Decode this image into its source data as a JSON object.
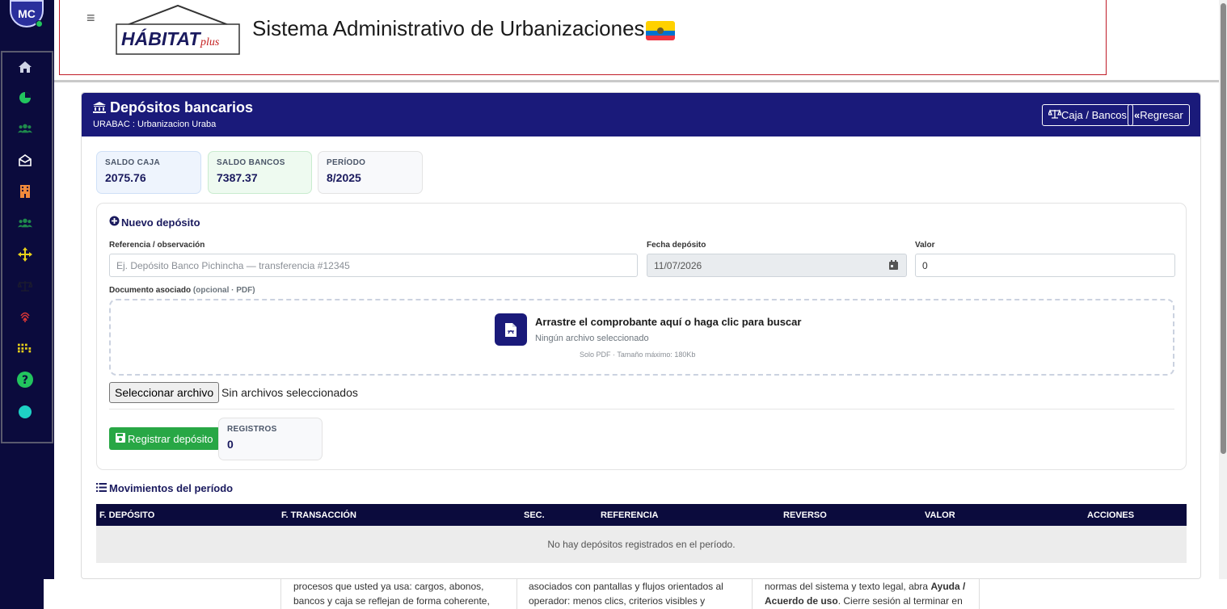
{
  "user": {
    "initials": "MC"
  },
  "header": {
    "logo_text": "HÁBITAT",
    "logo_suffix": "plus",
    "title": "Sistema Administrativo de Urbanizaciones"
  },
  "sidebar": {
    "icons": [
      "home-icon",
      "pie-chart-icon",
      "users-icon",
      "envelope-open-icon",
      "building-icon",
      "users-icon",
      "arrows-icon",
      "scale-icon",
      "fingerprint-icon",
      "grid-dots-icon",
      "help-icon",
      "circle-icon"
    ]
  },
  "page": {
    "title": "Depósitos bancarios",
    "subtitle": "URABAC : Urbanizacion Uraba",
    "caja_bancos_label": "Caja / Bancos",
    "regresar_label": "Regresar"
  },
  "stats": {
    "saldo_caja_label": "SALDO CAJA",
    "saldo_caja_value": "2075.76",
    "saldo_bancos_label": "SALDO BANCOS",
    "saldo_bancos_value": "7387.37",
    "periodo_label": "PERÍODO",
    "periodo_value": "8/2025"
  },
  "form": {
    "section_title": "Nuevo depósito",
    "referencia_label": "Referencia / observación",
    "referencia_placeholder": "Ej. Depósito Banco Pichincha — transferencia #12345",
    "fecha_label": "Fecha depósito",
    "fecha_value": "11/07/2026",
    "valor_label": "Valor",
    "valor_value": "0",
    "documento_label": "Documento asociado",
    "documento_hint": "(opcional · PDF)",
    "drop_title": "Arrastre el comprobante aquí o haga clic para buscar",
    "drop_status": "Ningún archivo seleccionado",
    "drop_note": "Solo PDF · Tamaño máximo: 180Kb",
    "file_button": "Seleccionar archivo",
    "file_status": "Sin archivos seleccionados",
    "submit_label": "Registrar depósito",
    "registros_label": "REGISTROS",
    "registros_value": "0"
  },
  "movimientos": {
    "title": "Movimientos del período",
    "columns": [
      "F. DEPÓSITO",
      "F. TRANSACCIÓN",
      "SEC.",
      "REFERENCIA",
      "REVERSO",
      "VALOR",
      "ACCIONES"
    ],
    "empty_message": "No hay depósitos registrados en el período."
  },
  "footer": {
    "col1_line1": "procesos que usted ya usa: cargos, abonos,",
    "col1_line2": "bancos y caja se reflejan de forma coherente,",
    "col2_line1": "asociados con pantallas y flujos orientados al",
    "col2_line2": "operador: menos clics, criterios visibles y",
    "col3_line1_a": "normas del sistema y texto legal, abra ",
    "col3_line1_b": "Ayuda /",
    "col3_line2_a": "Acuerdo de uso",
    "col3_line2_b": ". Cierre sesión al terminar en"
  },
  "colors": {
    "sidebar_bg": "#0b0b3d",
    "header_bg": "#1a1a7a",
    "success": "#28a745",
    "header_border": "#c01c28"
  }
}
